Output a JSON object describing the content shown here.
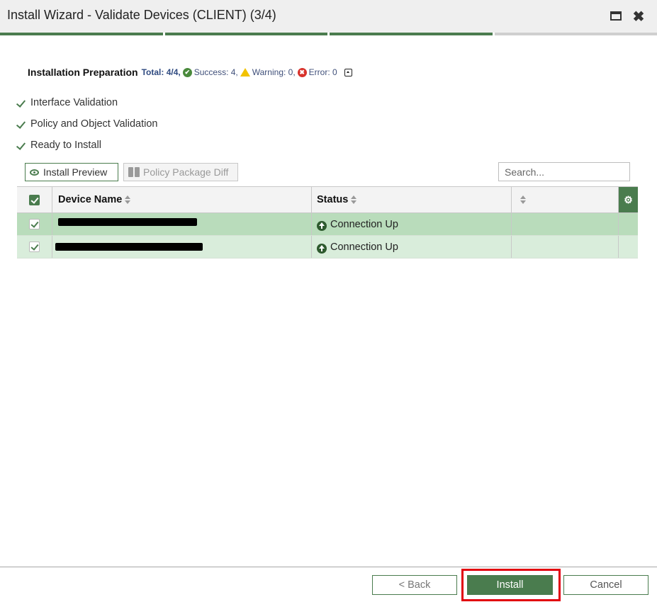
{
  "window": {
    "title": "Install Wizard - Validate Devices (CLIENT) (3/4)",
    "maximize_icon": "maximize-icon",
    "close_icon": "close-icon",
    "close_glyph": "✖",
    "progress_steps": [
      {
        "done": true
      },
      {
        "done": true
      },
      {
        "done": true
      },
      {
        "done": false
      }
    ]
  },
  "summary": {
    "label": "Installation Preparation",
    "total": "Total: 4/4,",
    "success": "Success: 4,",
    "warning": "Warning: 0,",
    "error": "Error: 0",
    "success_glyph": "✔",
    "error_glyph": "✖"
  },
  "checklist": [
    "Interface Validation",
    "Policy and Object Validation",
    "Ready to Install"
  ],
  "toolbar": {
    "install_preview": "Install Preview",
    "policy_package_diff": "Policy Package Diff",
    "search_placeholder": "Search..."
  },
  "table": {
    "columns": {
      "device_name": "Device Name",
      "status": "Status",
      "extra": ""
    },
    "gear_glyph": "⚙",
    "rows": [
      {
        "device_name": "[redacted]",
        "status": "Connection Up",
        "checked": true
      },
      {
        "device_name": "[redacted]",
        "status": "Connection Up",
        "checked": true
      }
    ]
  },
  "footer": {
    "back": "< Back",
    "install": "Install",
    "cancel": "Cancel"
  },
  "colors": {
    "accent": "#4a7c4e",
    "row_selected": "#b9dcbb",
    "row_alt": "#d9eddb",
    "highlight": "#e2000f"
  }
}
